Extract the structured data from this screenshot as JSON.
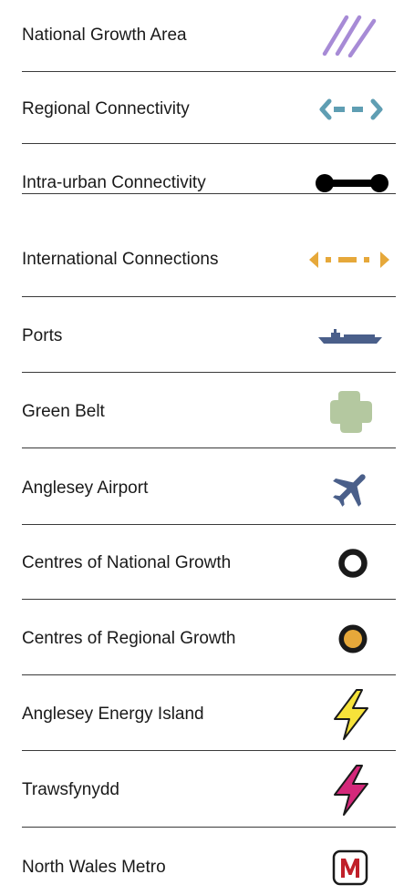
{
  "legend": {
    "items": [
      {
        "label": "National Growth Area",
        "icon": "diagonal-hatch-icon",
        "color": "#a78bd6"
      },
      {
        "label": "Regional Connectivity",
        "icon": "dashed-double-arrow-icon",
        "color": "#5f9eb3"
      },
      {
        "label": "Intra-urban Connectivity",
        "icon": "connector-line-icon",
        "color": "#000000"
      },
      {
        "label": "International Connections",
        "icon": "dashed-triangle-arrow-icon",
        "color": "#e6a83a"
      },
      {
        "label": "Ports",
        "icon": "ship-icon",
        "color": "#4a5f8a"
      },
      {
        "label": "Green Belt",
        "icon": "green-blob-icon",
        "color": "#b4c8a0"
      },
      {
        "label": "Anglesey Airport",
        "icon": "airplane-icon",
        "color": "#4a5f8a"
      },
      {
        "label": "Centres of National Growth",
        "icon": "ring-icon",
        "color": "#1a1a1a"
      },
      {
        "label": "Centres of Regional Growth",
        "icon": "yellow-dot-ring-icon",
        "color": "#e6a83a"
      },
      {
        "label": "Anglesey Energy Island",
        "icon": "yellow-lightning-icon",
        "color": "#f7e33a"
      },
      {
        "label": "Trawsfynydd",
        "icon": "magenta-lightning-icon",
        "color": "#d4287a"
      },
      {
        "label": "North Wales Metro",
        "icon": "metro-m-icon",
        "color": "#c0202a"
      }
    ]
  }
}
